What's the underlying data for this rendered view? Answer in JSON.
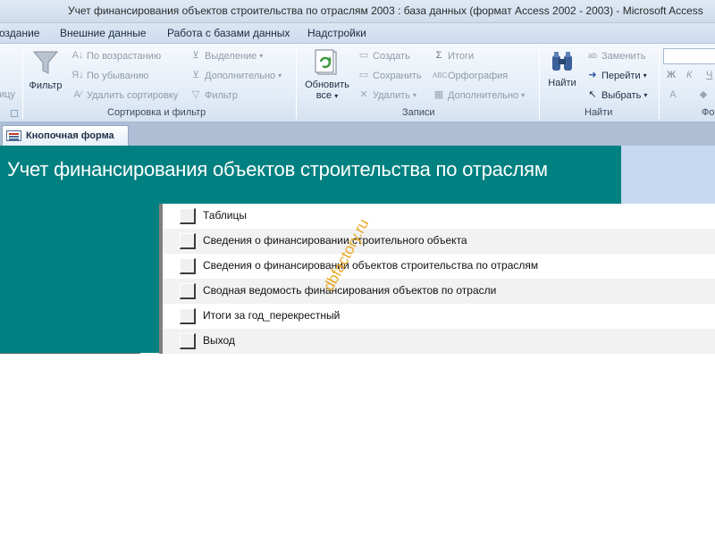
{
  "window": {
    "title": "Учет финансирования объектов строительства по отраслям 2003 : база данных (формат Access 2002 - 2003)  -  Microsoft Access"
  },
  "ribbon_tabs": [
    "оздание",
    "Внешние данные",
    "Работа с базами данных",
    "Надстройки"
  ],
  "ribbon": {
    "cut_left_label": "ицу",
    "sort_group": {
      "filter_label": "Фильтр",
      "ascending": "По возрастанию",
      "descending": "По убыванию",
      "clear_sort": "Удалить сортировку",
      "selection": "Выделение",
      "advanced": "Дополнительно",
      "toggle_filter": "Фильтр",
      "group_label": "Сортировка и фильтр"
    },
    "records_group": {
      "refresh_label_1": "Обновить",
      "refresh_label_2": "все",
      "new": "Создать",
      "save": "Сохранить",
      "delete": "Удалить",
      "totals": "Итоги",
      "spelling": "Орфография",
      "more": "Дополнительно",
      "group_label": "Записи"
    },
    "find_group": {
      "find_label": "Найти",
      "replace": "Заменить",
      "goto": "Перейти",
      "select": "Выбрать",
      "group_label": "Найти"
    },
    "font_group": {
      "bold": "Ж",
      "italic": "К",
      "underline": "Ч",
      "group_label": "Фо"
    }
  },
  "doc_tab": {
    "label": "Кнопочная форма"
  },
  "form": {
    "heading": "Учет финансирования объектов строительства по отраслям",
    "items": [
      "Таблицы",
      "Сведения о финансировании строительного объекта",
      "Сведения о финансировании объектов строительства по отраслям",
      "Сводная ведомость финансирования объектов по отрасли",
      "Итоги за год_перекрестный",
      "Выход"
    ]
  },
  "watermark": "dbfactory.ru",
  "colors": {
    "form_teal": "#008080",
    "accent_blue": "#c6d9f0",
    "watermark": "#e8a10e"
  }
}
